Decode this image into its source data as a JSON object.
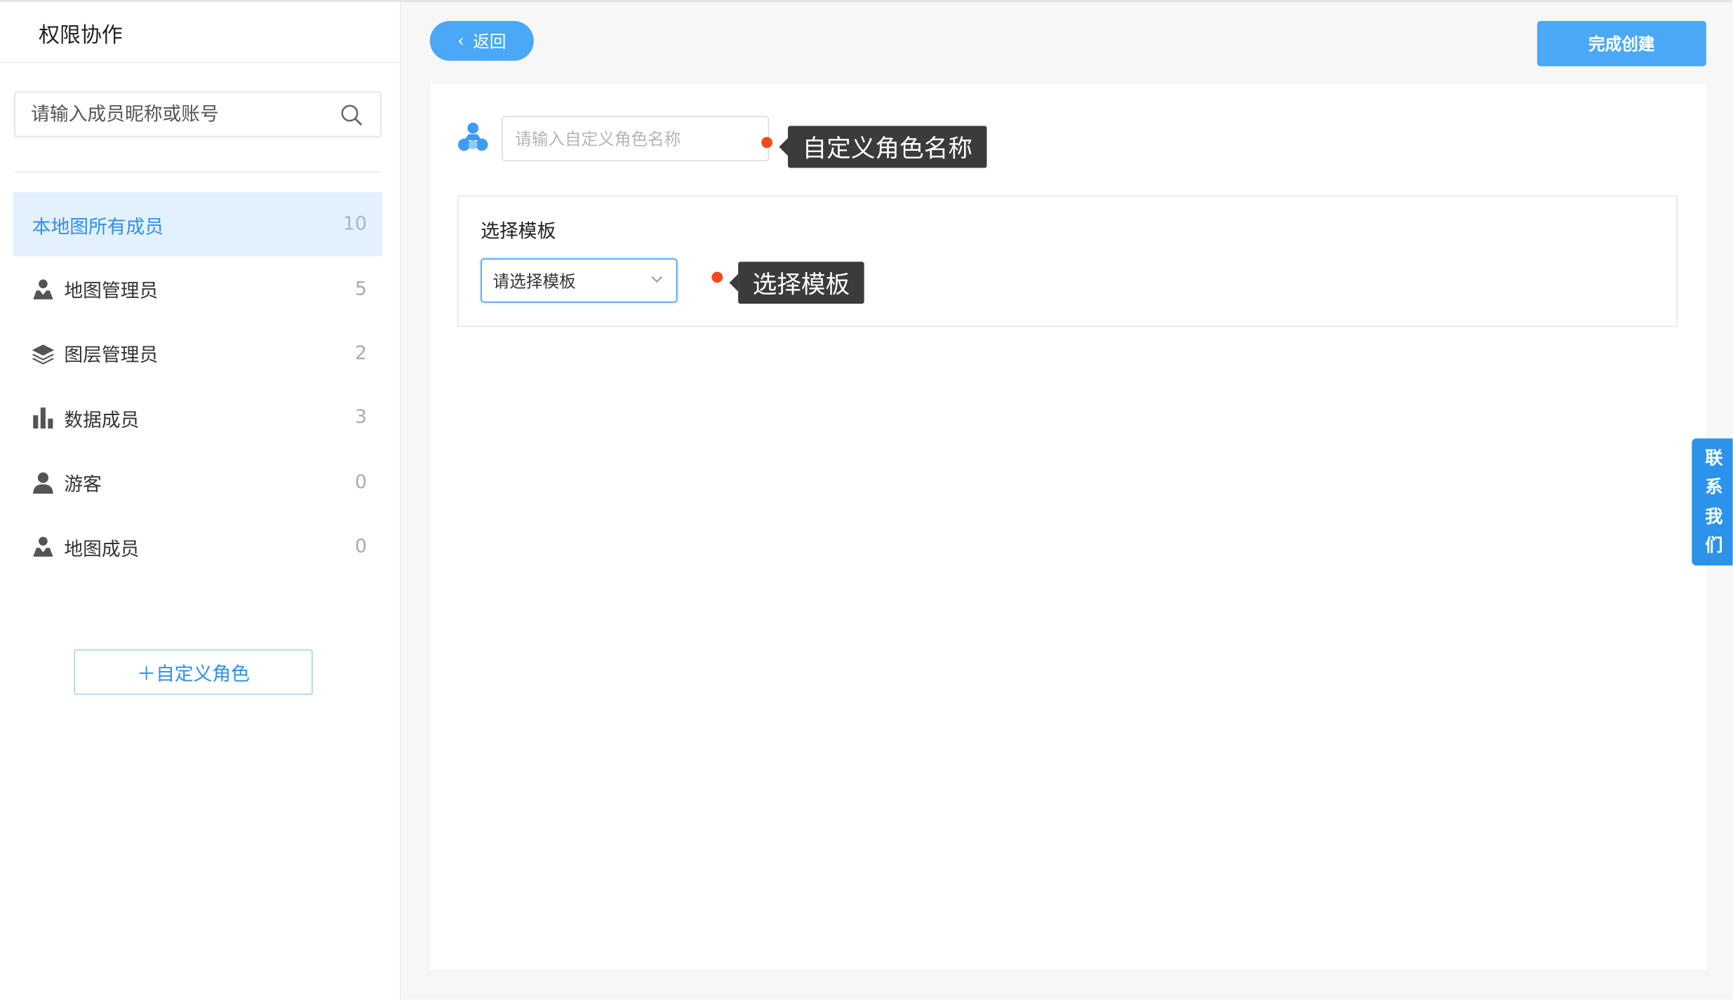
{
  "sidebar": {
    "title": "权限协作",
    "search_placeholder": "请输入成员昵称或账号",
    "items": [
      {
        "label": "本地图所有成员",
        "count": "10",
        "icon": "none",
        "active": true
      },
      {
        "label": "地图管理员",
        "count": "5",
        "icon": "map-user-icon"
      },
      {
        "label": "图层管理员",
        "count": "2",
        "icon": "layers-icon"
      },
      {
        "label": "数据成员",
        "count": "3",
        "icon": "bar-chart-icon"
      },
      {
        "label": "游客",
        "count": "0",
        "icon": "user-icon"
      },
      {
        "label": "地图成员",
        "count": "0",
        "icon": "map-user-icon"
      }
    ],
    "custom_role_button": "＋自定义角色"
  },
  "header": {
    "back_label": "返回",
    "finish_label": "完成创建"
  },
  "form": {
    "role_name_placeholder": "请输入自定义角色名称",
    "role_name_tooltip": "自定义角色名称",
    "template_title": "选择模板",
    "template_select_value": "请选择模板",
    "template_tooltip": "选择模板"
  },
  "contact": [
    "联",
    "系",
    "我",
    "们"
  ],
  "colors": {
    "accent": "#4aa8f7",
    "active_bg": "#e3f1fd",
    "active_text": "#2c8ff1",
    "marker": "#f04a1b",
    "tooltip_bg": "#3b3b3b",
    "contact_bg": "#2b93ea"
  }
}
